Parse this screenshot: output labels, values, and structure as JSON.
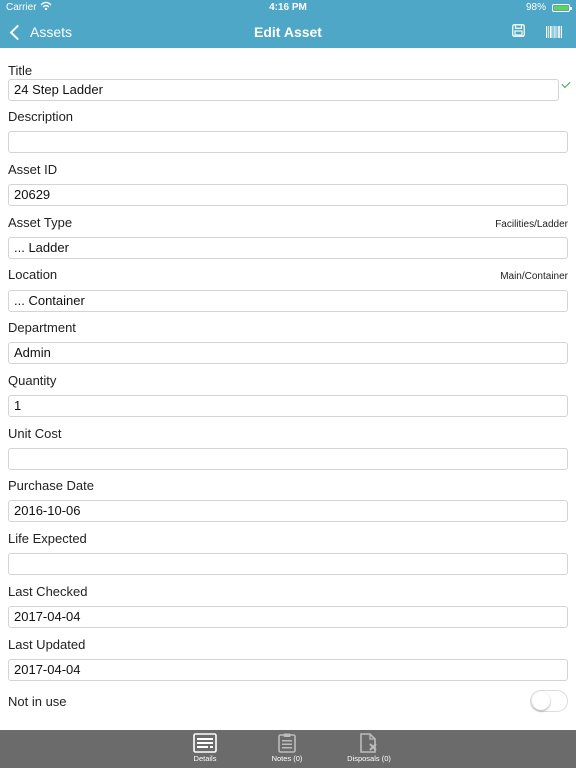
{
  "status_bar": {
    "carrier": "Carrier",
    "time": "4:16 PM",
    "battery_percent": "98%",
    "battery_level": 0.98,
    "battery_color": "#62d35a"
  },
  "nav_bar": {
    "back_label": "Assets",
    "title": "Edit Asset",
    "icons": [
      "chevron-left-icon",
      "save-icon",
      "barcode-icon"
    ],
    "bg_color": "#4ea7c6"
  },
  "fields": {
    "title": {
      "label": "Title",
      "value": "24 Step Ladder"
    },
    "description": {
      "label": "Description",
      "value": ""
    },
    "asset_id": {
      "label": "Asset ID",
      "value": "20629"
    },
    "asset_type": {
      "label": "Asset Type",
      "hint": "Facilities/Ladder",
      "value": "... Ladder"
    },
    "location": {
      "label": "Location",
      "hint": "Main/Container",
      "value": "... Container"
    },
    "department": {
      "label": "Department",
      "value": "Admin"
    },
    "quantity": {
      "label": "Quantity",
      "value": "1"
    },
    "unit_cost": {
      "label": "Unit Cost",
      "value": ""
    },
    "purchase_date": {
      "label": "Purchase Date",
      "value": "2016-10-06"
    },
    "life_expected": {
      "label": "Life Expected",
      "value": ""
    },
    "last_checked": {
      "label": "Last Checked",
      "value": "2017-04-04"
    },
    "last_updated": {
      "label": "Last Updated",
      "value": "2017-04-04"
    },
    "not_in_use": {
      "label": "Not in use",
      "on": false
    }
  },
  "tab_bar": {
    "tabs": [
      {
        "label": "Details",
        "icon": "details-icon",
        "active": true
      },
      {
        "label": "Notes (0)",
        "icon": "clipboard-icon",
        "active": false
      },
      {
        "label": "Disposals (0)",
        "icon": "disposal-icon",
        "active": false
      }
    ],
    "bg_color": "#6b6b6b"
  }
}
